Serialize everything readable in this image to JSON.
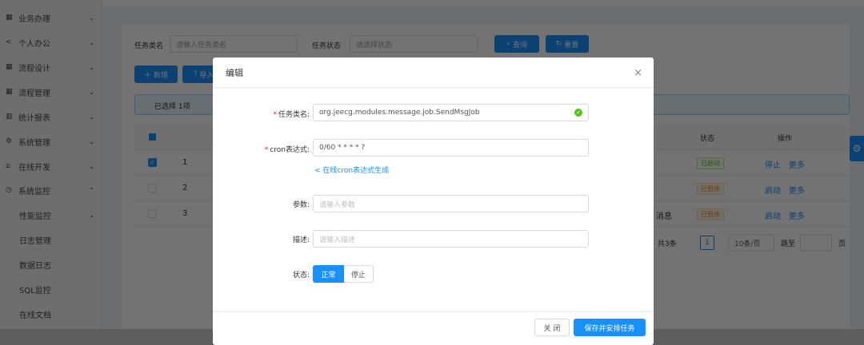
{
  "sidebar": {
    "items": [
      {
        "icon": "▦",
        "label": "业务办理",
        "chevron": "⌄"
      },
      {
        "icon": "<",
        "label": "个人办公",
        "chevron": "⌄"
      },
      {
        "icon": "▦",
        "label": "流程设计",
        "chevron": "⌄"
      },
      {
        "icon": "▦",
        "label": "流程管理",
        "chevron": "⌄"
      },
      {
        "icon": "▥",
        "label": "统计报表",
        "chevron": "⌄"
      },
      {
        "icon": "⚙",
        "label": "系统管理",
        "chevron": "⌄"
      },
      {
        "icon": "⌂",
        "label": "在线开发",
        "chevron": "⌄"
      },
      {
        "icon": "◷",
        "label": "系统监控",
        "chevron": "⌃"
      }
    ],
    "subitems": [
      {
        "label": "性能监控",
        "chevron": "⌄"
      },
      {
        "label": "日志管理"
      },
      {
        "label": "数据日志"
      },
      {
        "label": "SQL监控"
      },
      {
        "label": "在线文档"
      }
    ]
  },
  "search": {
    "name_label": "任务类名",
    "name_placeholder": "请输入任务类名",
    "status_label": "任务状态",
    "status_placeholder": "请选择状态",
    "query": "查询",
    "reset": "重置"
  },
  "toolbar": {
    "add": "新增",
    "import": "导入"
  },
  "alert": {
    "text": "已选择 1项"
  },
  "table": {
    "status_header": "状态",
    "action_header": "操作",
    "rows": [
      {
        "num": "1",
        "checked": true,
        "status": "已启动",
        "status_color": "#52c41a",
        "action": "停止",
        "more": "更多"
      },
      {
        "num": "2",
        "checked": false,
        "status": "已暂停",
        "status_color": "#fa8c16",
        "action": "启动",
        "more": "更多"
      },
      {
        "num": "3",
        "checked": false,
        "extra": "消息",
        "status": "已暂停",
        "status_color": "#fa8c16",
        "action": "启动",
        "more": "更多"
      }
    ]
  },
  "pagination": {
    "total": "共3条",
    "page": "1",
    "page_size": "10条/页",
    "goto": "跳至",
    "page_suffix": "页"
  },
  "modal": {
    "title": "编辑",
    "close": "×",
    "fields": {
      "job_class": {
        "label": "任务类名:",
        "value": "org.jeecg.modules.message.job.SendMsgJob"
      },
      "cron": {
        "label": "cron表达式:",
        "value": "0/60 * * * * ?"
      },
      "cron_link": "在线cron表达式生成",
      "param": {
        "label": "参数:",
        "placeholder": "请输入参数"
      },
      "desc": {
        "label": "描述:",
        "placeholder": "请输入描述"
      },
      "status": {
        "label": "状态:",
        "options": [
          "正常",
          "停止"
        ],
        "selected": "正常"
      }
    },
    "cancel": "关 闭",
    "save": "保存并安排任务"
  },
  "colors": {
    "primary": "#1890ff",
    "success": "#52c41a"
  }
}
